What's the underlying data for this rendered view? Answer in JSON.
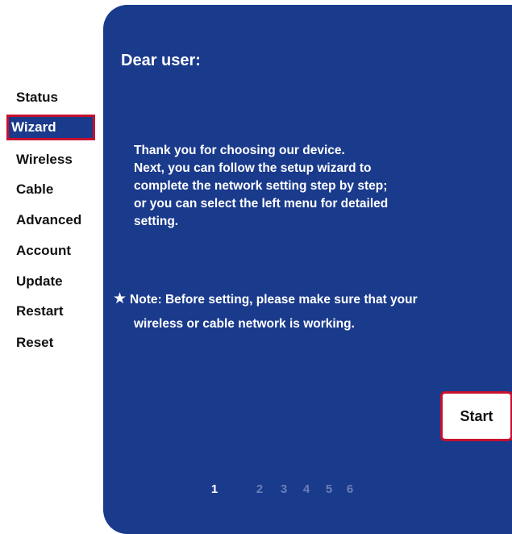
{
  "sidebar": {
    "items": [
      {
        "label": "Status"
      },
      {
        "label": "Wizard",
        "active": true
      },
      {
        "label": "Wireless"
      },
      {
        "label": "Cable"
      },
      {
        "label": "Advanced"
      },
      {
        "label": "Account"
      },
      {
        "label": "Update"
      },
      {
        "label": "Restart"
      },
      {
        "label": "Reset"
      }
    ]
  },
  "main": {
    "greeting": "Dear user:",
    "message_lines": [
      "Thank you for choosing our device.",
      "Next, you can follow the setup wizard to",
      "complete the network setting step by step;",
      "or you can select the left menu for detailed",
      "setting."
    ],
    "note_line1": "Note: Before setting, please make sure that your",
    "note_line2": "wireless or cable network is working.",
    "star_icon": "★",
    "start_label": "Start",
    "steps": [
      "1",
      "2",
      "3",
      "4",
      "5",
      "6"
    ],
    "current_step": "1"
  },
  "colors": {
    "panel": "#1a3a8c",
    "accent": "#c8102e",
    "inactive_step": "#6a7fb8"
  }
}
